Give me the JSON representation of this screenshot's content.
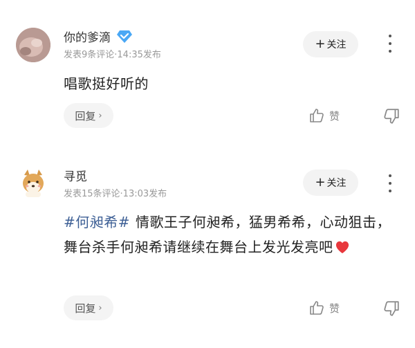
{
  "comments": [
    {
      "username": "你的爹滴",
      "verified_badge": "vip-diamond-icon",
      "meta": "发表9条评论·14:35发布",
      "follow_label": "关注",
      "content_hashtag": "",
      "content": "唱歌挺好听的",
      "has_heart": false,
      "reply_label": "回复",
      "like_label": "赞"
    },
    {
      "username": "寻觅",
      "verified_badge": "",
      "meta": "发表15条评论·13:03发布",
      "follow_label": "关注",
      "content_hashtag": "#何昶希#",
      "content": "情歌王子何昶希，猛男希希，心动狙击，舞台杀手何昶希请继续在舞台上发光发亮吧",
      "has_heart": true,
      "reply_label": "回复",
      "like_label": "赞"
    }
  ],
  "colors": {
    "hashtag": "#3d5f95",
    "vip_badge": "#4aa8f5",
    "heart": "#e8383d",
    "button_bg": "#f3f3f3",
    "meta_text": "#999999"
  }
}
